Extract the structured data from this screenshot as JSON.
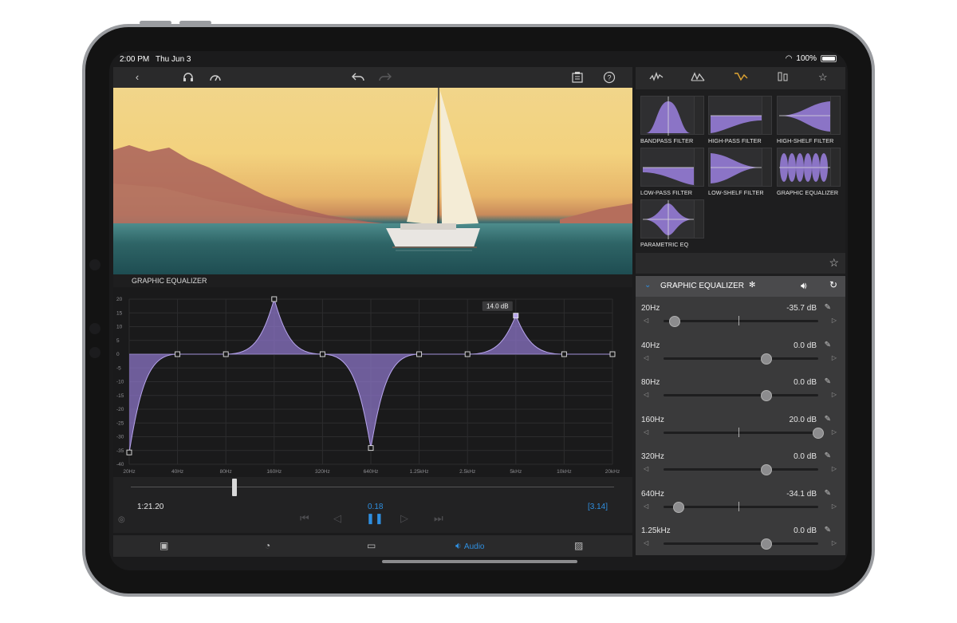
{
  "status_bar": {
    "time": "2:00 PM",
    "date": "Thu Jun 3",
    "battery": "100%"
  },
  "toolbar": {
    "icons": [
      "back-chevron-icon",
      "headphones-icon",
      "speedometer-icon",
      "undo-icon",
      "redo-icon",
      "clipboard-icon",
      "help-icon"
    ]
  },
  "editor": {
    "panel_title": "GRAPHIC EQUALIZER",
    "tooltip": "14.0 dB"
  },
  "chart_data": {
    "type": "line",
    "title": "",
    "x": [
      "20Hz",
      "40Hz",
      "80Hz",
      "160Hz",
      "320Hz",
      "640Hz",
      "1.25kHz",
      "2.5kHz",
      "5kHz",
      "10kHz",
      "20kHz"
    ],
    "y_ticks": [
      "20",
      "15",
      "10",
      "5",
      "0",
      "-5",
      "-10",
      "-15",
      "-20",
      "-25",
      "-30",
      "-35",
      "-40"
    ],
    "ylim": [
      -40,
      20
    ],
    "series": [
      {
        "values": [
          -35.7,
          0,
          0,
          20,
          0,
          -34.1,
          0,
          0,
          14,
          0,
          0
        ]
      }
    ],
    "fill_color": "#8b74c6",
    "grid": true
  },
  "playback": {
    "timecode": "1:21.20",
    "selection": "0.18",
    "duration": "[3.14]"
  },
  "bottom_bar": {
    "audio_label": "Audio"
  },
  "right_panel": {
    "presets": [
      {
        "label": "BANDPASS FILTER"
      },
      {
        "label": "HIGH-PASS FILTER"
      },
      {
        "label": "HIGH-SHELF FILTER"
      },
      {
        "label": "LOW-PASS FILTER"
      },
      {
        "label": "LOW-SHELF FILTER"
      },
      {
        "label": "GRAPHIC EQUALIZER"
      },
      {
        "label": "PARAMETRIC EQ"
      }
    ],
    "eq_header": "GRAPHIC EQUALIZER",
    "bands": [
      {
        "name": "20Hz",
        "value": "-35.7 dB",
        "level": -35.7
      },
      {
        "name": "40Hz",
        "value": "0.0 dB",
        "level": 0
      },
      {
        "name": "80Hz",
        "value": "0.0 dB",
        "level": 0
      },
      {
        "name": "160Hz",
        "value": "20.0 dB",
        "level": 20
      },
      {
        "name": "320Hz",
        "value": "0.0 dB",
        "level": 0
      },
      {
        "name": "640Hz",
        "value": "-34.1 dB",
        "level": -34.1
      },
      {
        "name": "1.25kHz",
        "value": "0.0 dB",
        "level": 0
      }
    ]
  },
  "colors": {
    "accent_blue": "#2f8fe0",
    "accent_orange": "#e0a532",
    "eq_fill": "#8b74c6"
  }
}
